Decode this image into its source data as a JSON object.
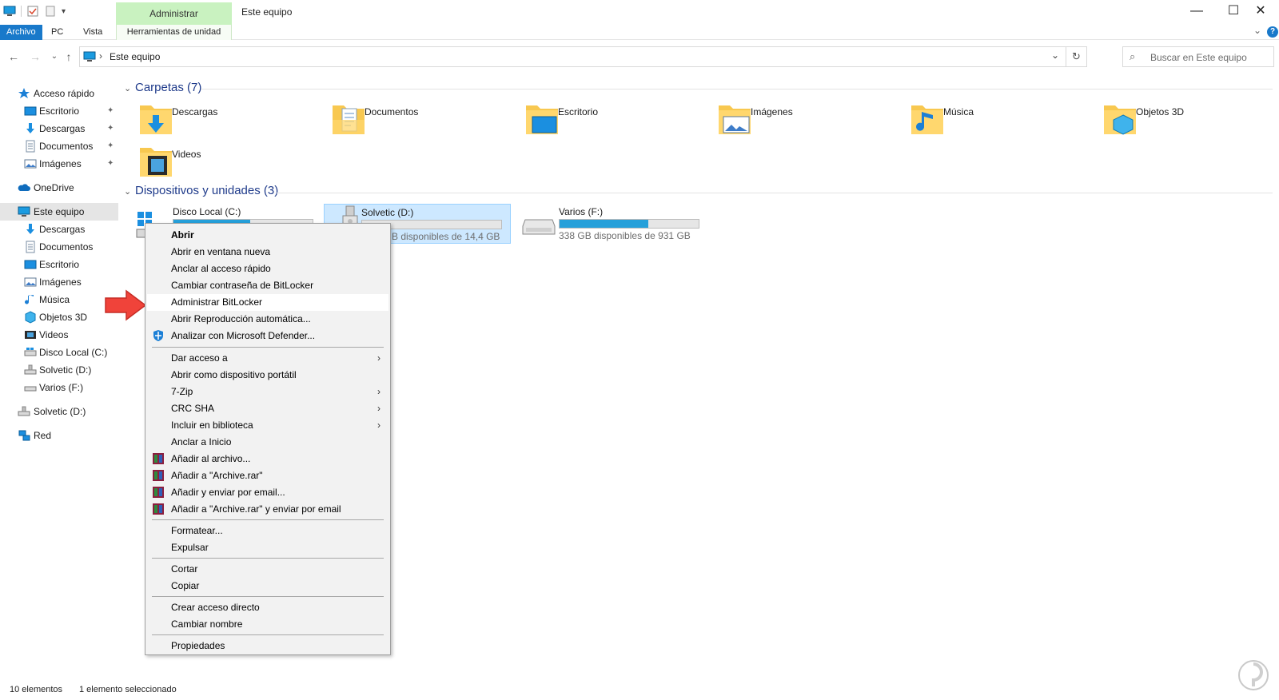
{
  "window": {
    "title": "Este equipo",
    "contextual_tab_header": "Administrar",
    "minimize": "—",
    "maximize": "☐",
    "close": "✕"
  },
  "ribbon": {
    "tabs": [
      {
        "label": "Archivo"
      },
      {
        "label": "PC"
      },
      {
        "label": "Vista"
      },
      {
        "label": "Herramientas de unidad"
      }
    ],
    "expand_glyph": "⌄",
    "help_glyph": "?"
  },
  "nav": {
    "back": "←",
    "forward": "→",
    "recent": "⌄",
    "up": "↑",
    "address": "Este equipo",
    "address_sep": "›",
    "address_dropdown": "⌄",
    "refresh": "↻",
    "search_placeholder": "Buscar en Este equipo",
    "search_glyph": "⌕"
  },
  "sidebar": {
    "items": [
      {
        "label": "Acceso rápido",
        "icon": "star-icon"
      },
      {
        "label": "Escritorio",
        "icon": "desktop-icon",
        "pinned": true
      },
      {
        "label": "Descargas",
        "icon": "download-icon",
        "pinned": true
      },
      {
        "label": "Documentos",
        "icon": "document-icon",
        "pinned": true
      },
      {
        "label": "Imágenes",
        "icon": "image-icon",
        "pinned": true
      },
      {
        "label": "OneDrive",
        "icon": "cloud-icon"
      },
      {
        "label": "Este equipo",
        "icon": "pc-icon",
        "selected": true
      },
      {
        "label": "Descargas",
        "icon": "download-icon"
      },
      {
        "label": "Documentos",
        "icon": "document-icon"
      },
      {
        "label": "Escritorio",
        "icon": "desktop-icon"
      },
      {
        "label": "Imágenes",
        "icon": "image-icon"
      },
      {
        "label": "Música",
        "icon": "music-icon"
      },
      {
        "label": "Objetos 3D",
        "icon": "cube-icon"
      },
      {
        "label": "Videos",
        "icon": "video-icon"
      },
      {
        "label": "Disco Local (C:)",
        "icon": "drive-icon"
      },
      {
        "label": "Solvetic (D:)",
        "icon": "usb-drive-icon"
      },
      {
        "label": "Varios (F:)",
        "icon": "drive-icon"
      },
      {
        "label": "Solvetic (D:)",
        "icon": "usb-drive-icon"
      },
      {
        "label": "Red",
        "icon": "network-icon"
      }
    ],
    "pin_glyph": "📌"
  },
  "content": {
    "folders_header": "Carpetas (7)",
    "folders": [
      {
        "name": "Descargas",
        "icon": "downloads-folder-icon"
      },
      {
        "name": "Documentos",
        "icon": "documents-folder-icon"
      },
      {
        "name": "Escritorio",
        "icon": "desktop-folder-icon"
      },
      {
        "name": "Imágenes",
        "icon": "pictures-folder-icon"
      },
      {
        "name": "Música",
        "icon": "music-folder-icon"
      },
      {
        "name": "Objetos 3D",
        "icon": "3d-objects-folder-icon"
      },
      {
        "name": "Videos",
        "icon": "videos-folder-icon"
      }
    ],
    "devices_header": "Dispositivos y unidades (3)",
    "drives": [
      {
        "name": "Disco Local (C:)",
        "free": "",
        "used_fraction": 0.55,
        "selected": false
      },
      {
        "name": "Solvetic (D:)",
        "free": "B disponibles de 14,4 GB",
        "used_fraction": 0.0,
        "selected": true
      },
      {
        "name": "Varios (F:)",
        "free": "338 GB disponibles de 931 GB",
        "used_fraction": 0.64,
        "selected": false
      }
    ]
  },
  "context_menu": {
    "items": [
      {
        "label": "Abrir",
        "bold": true
      },
      {
        "label": "Abrir en ventana nueva"
      },
      {
        "label": "Anclar al acceso rápido"
      },
      {
        "label": "Cambiar contraseña de BitLocker"
      },
      {
        "label": "Administrar BitLocker",
        "highlighted": true
      },
      {
        "label": "Abrir Reproducción automática..."
      },
      {
        "label": "Analizar con Microsoft Defender...",
        "icon": "defender-shield-icon"
      },
      {
        "label": "Dar acceso a",
        "submenu": true
      },
      {
        "label": "Abrir como dispositivo portátil"
      },
      {
        "label": "7-Zip",
        "submenu": true
      },
      {
        "label": "CRC SHA",
        "submenu": true
      },
      {
        "label": "Incluir en biblioteca",
        "submenu": true
      },
      {
        "label": "Anclar a Inicio"
      },
      {
        "label": "Añadir al archivo...",
        "icon": "winrar-icon"
      },
      {
        "label": "Añadir a \"Archive.rar\"",
        "icon": "winrar-icon"
      },
      {
        "label": "Añadir y enviar por email...",
        "icon": "winrar-icon"
      },
      {
        "label": "Añadir a \"Archive.rar\" y enviar por email",
        "icon": "winrar-icon"
      },
      {
        "label": "Formatear..."
      },
      {
        "label": "Expulsar"
      },
      {
        "label": "Cortar"
      },
      {
        "label": "Copiar"
      },
      {
        "label": "Crear acceso directo"
      },
      {
        "label": "Cambiar nombre"
      },
      {
        "label": "Propiedades"
      }
    ],
    "submenu_glyph": "›"
  },
  "status": {
    "count": "10 elementos",
    "selection": "1 elemento seleccionado"
  },
  "colors": {
    "accent": "#1979ca",
    "contextual_tab": "#c9f2c0",
    "drive_bar": "#26a0da",
    "selection": "#cde8ff",
    "arrow": "#f0433a"
  }
}
